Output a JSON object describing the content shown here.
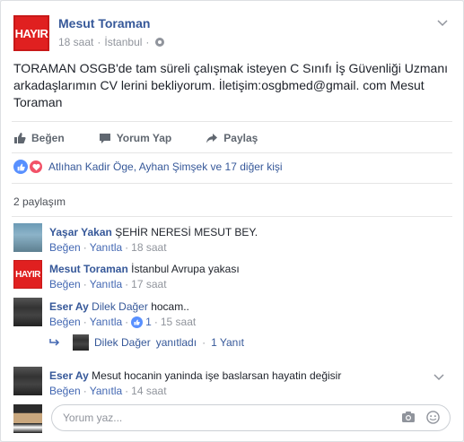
{
  "post": {
    "author": "Mesut Toraman",
    "logo_text": "HAYIR",
    "time": "18 saat",
    "sep": "·",
    "location": "İstanbul",
    "text": "TORAMAN OSGB'de tam süreli çalışmak isteyen C Sınıfı İş Güvenliği Uzmanı arkadaşlarımın CV lerini bekliyorum. İletişim:osgbmed@gmail. com Mesut Toraman"
  },
  "actions": {
    "like": "Beğen",
    "comment": "Yorum Yap",
    "share": "Paylaş"
  },
  "reactions": {
    "summary": "Atlıhan Kadir Öge, Ayhan Şimşek ve 17 diğer kişi"
  },
  "shares": "2 paylaşım",
  "comments": [
    {
      "name": "Yaşar Yakan",
      "text": "ŞEHİR NERESİ MESUT BEY.",
      "like": "Beğen",
      "reply": "Yanıtla",
      "time": "18 saat"
    },
    {
      "name": "Mesut Toraman",
      "text": "İstanbul Avrupa yakası",
      "like": "Beğen",
      "reply": "Yanıtla",
      "time": "17 saat",
      "logo_text": "HAYIR"
    },
    {
      "name": "Eser Ay",
      "tag": "Dilek Dağer",
      "text": "hocam..",
      "like": "Beğen",
      "reply": "Yanıtla",
      "likes": "1",
      "time": "15 saat"
    },
    {
      "name": "Eser Ay",
      "text": "Mesut hocanin yaninda işe baslarsan hayatin değisir",
      "like": "Beğen",
      "reply": "Yanıtla",
      "time": "14 saat"
    }
  ],
  "reply_summary": {
    "name": "Dilek Dağer",
    "action": "yanıtladı",
    "sep": "·",
    "count": "1 Yanıt"
  },
  "compose": {
    "placeholder": "Yorum yaz..."
  },
  "dot": "·",
  "colors": {
    "brand": "#365899",
    "logo_red": "#e02020",
    "like_blue": "#5890ff",
    "love_red": "#f25268"
  }
}
